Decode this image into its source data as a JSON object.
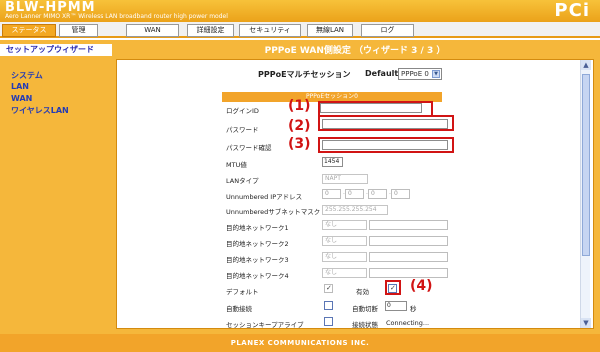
{
  "header": {
    "brand": "BLW-HPMM",
    "subtitle": "Aero Lanner MIMO XR™ Wireless LAN broadband router high power model",
    "logo": "PCi"
  },
  "nav": {
    "tabs": [
      {
        "label": "ステータス",
        "active": true
      },
      {
        "label": "管理",
        "active": false
      },
      {
        "label": "WAN",
        "active": false
      },
      {
        "label": "詳細設定",
        "active": false
      },
      {
        "label": "セキュリティ",
        "active": false
      },
      {
        "label": "無線LAN",
        "active": false
      },
      {
        "label": "ログ",
        "active": false
      }
    ]
  },
  "sidebar": {
    "heading": "セットアップウィザード",
    "items": [
      "システム",
      "LAN",
      "WAN",
      "ワイヤレスLAN"
    ]
  },
  "panel": {
    "title": "PPPoE WAN側設定 （ウィザード 3 / 3 ）",
    "multi_session_label": "PPPoEマルチセッション",
    "default_label": "Default",
    "default_select": "PPPoE 0",
    "section_title": "PPPoEセッション0",
    "fields": {
      "login_id": "ログインID",
      "password": "パスワード",
      "password_confirm": "パスワード確認",
      "mtu": "MTU値",
      "mtu_value": "1454",
      "lan_type": "LANタイプ",
      "lan_type_value": "NAPT",
      "unnumbered_ip": "Unnumbered IPアドレス",
      "ip_octets": [
        "0",
        "0",
        "0",
        "0"
      ],
      "unnumbered_mask": "Unnumberedサブネットマスク",
      "mask_value": "255.255.255.254",
      "dest1": "目的地ネットワーク1",
      "dest2": "目的地ネットワーク2",
      "dest3": "目的地ネットワーク3",
      "dest4": "目的地ネットワーク4",
      "dest_select": "なし",
      "default": "デフォルト",
      "enable": "有効",
      "auto_connect": "自動接続",
      "auto_disconnect": "自動切断",
      "auto_disconnect_value": "0",
      "seconds": "秒",
      "session_keepalive": "セッションキープアライブ",
      "connection_status_label": "接続状態",
      "connection_status": "Connecting..."
    },
    "callouts": [
      "(1)",
      "(2)",
      "(3)",
      "(4)"
    ]
  },
  "footer": {
    "text": "PLANEX COMMUNICATIONS INC."
  }
}
